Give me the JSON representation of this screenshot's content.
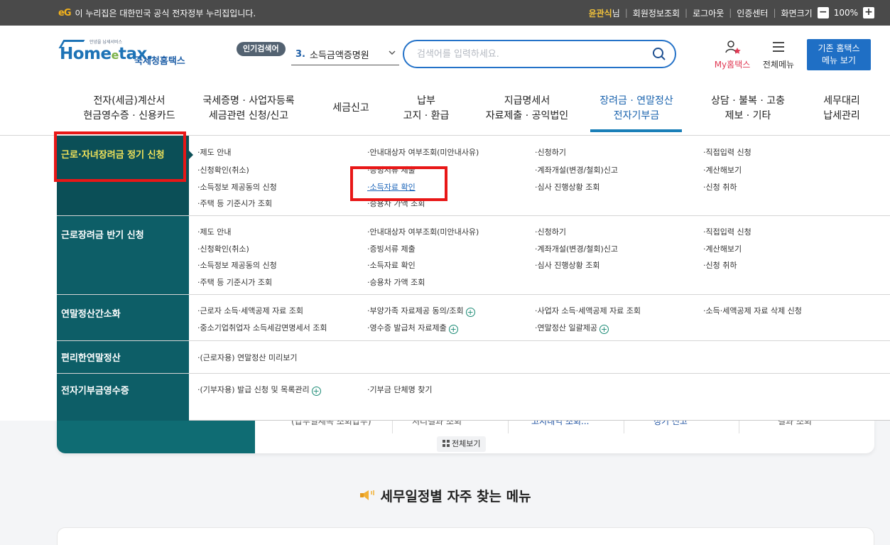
{
  "govbar": {
    "mark": "eG",
    "notice": "이 누리집은 대한민국 공식 전자정부 누리집입니다.",
    "user_name": "윤관식",
    "user_suffix": "님",
    "links": [
      "회원정보조회",
      "로그아웃",
      "인증센터"
    ],
    "screen_size_label": "화면크기",
    "zoom_minus": "−",
    "zoom_value": "100%",
    "zoom_plus": "+"
  },
  "header": {
    "logo_small": "안녕을 납세서비스",
    "logo_home": "Home",
    "logo_e": "e",
    "logo_tax": "tax.",
    "logo_kr": "국세청홈택스",
    "popular_label": "인기검색어",
    "popular_rank": "3.",
    "popular_term": "소득금액증명원",
    "search_placeholder": "검색어를 입력하세요.",
    "myhome_label": "My홈택스",
    "allmenu_label": "전체메뉴",
    "classic_line1": "기존 홈택스",
    "classic_line2": "메뉴 보기"
  },
  "gnb": [
    {
      "label": "전자(세금)계산서\n현금영수증 · 신용카드"
    },
    {
      "label": "국세증명 · 사업자등록\n세금관련 신청/신고"
    },
    {
      "label": "세금신고"
    },
    {
      "label": "납부\n고지 · 환급"
    },
    {
      "label": "지급명세서\n자료제출 · 공익법인"
    },
    {
      "label": "장려금 · 연말정산\n전자기부금"
    },
    {
      "label": "상담 · 불복 · 고충\n제보 · 기타"
    },
    {
      "label": "세무대리\n납세관리"
    }
  ],
  "mega": {
    "rows": [
      {
        "title": "근로·자녀장려금 정기 신청",
        "links": [
          "·제도 안내",
          "·안내대상자 여부조회(미안내사유)",
          "·신청하기",
          "·직접입력 신청",
          "·신청확인(취소)",
          "·증빙서류 제출",
          "·계좌개설(변경/철회)신고",
          "·계산해보기",
          "·소득정보 제공동의 신청",
          "·소득자료 확인",
          "·심사 진행상황 조회",
          "·신청 취하",
          "·주택 등 기준시가 조회",
          "·승용차 가액 조회"
        ]
      },
      {
        "title": "근로장려금 반기 신청",
        "links": [
          "·제도 안내",
          "·안내대상자 여부조회(미안내사유)",
          "·신청하기",
          "·직접입력 신청",
          "·신청확인(취소)",
          "·증빙서류 제출",
          "·계좌개설(변경/철회)신고",
          "·계산해보기",
          "·소득정보 제공동의 신청",
          "·소득자료 확인",
          "·심사 진행상황 조회",
          "·신청 취하",
          "·주택 등 기준시가 조회",
          "·승용차 가액 조회"
        ]
      },
      {
        "title": "연말정산간소화",
        "links": [
          "·근로자 소득·세액공제 자료 조회",
          "·부양가족 자료제공 동의/조회",
          "·사업자 소득·세액공제 자료 조회",
          "·소득·세액공제 자료 삭제 신청",
          "·중소기업취업자 소득세감면명세서 조회",
          "·영수증 발급처 자료제출",
          "·연말정산 일괄제공"
        ]
      },
      {
        "title": "편리한연말정산",
        "links": [
          "·(근로자용) 연말정산 미리보기"
        ]
      },
      {
        "title": "전자기부금영수증",
        "links": [
          "·(기부자용) 발급 신청 및 목록관리",
          "·기부금 단체명 찾기"
        ]
      }
    ],
    "plus_glyph": "+"
  },
  "behind": {
    "peek_items": [
      "(납부일세목 조회납부)",
      "처리결과 조회",
      "고지내역 조회...",
      "정기 신고",
      "결과 조회"
    ],
    "view_all": "전체보기",
    "schedule_title": "세무일정별 자주 찾는 메뉴"
  },
  "colors": {
    "govbar": "#4a4a4a",
    "brand_blue": "#1f6fc5",
    "mega_side": "#0d5e67",
    "active_title": "#f1e35a",
    "highlight_box": "#e81717"
  },
  "icons": [
    "search-icon",
    "user-icon",
    "hamburger-icon",
    "chevron-down-icon",
    "plus-circle-icon",
    "grid-icon",
    "bell-icon"
  ]
}
